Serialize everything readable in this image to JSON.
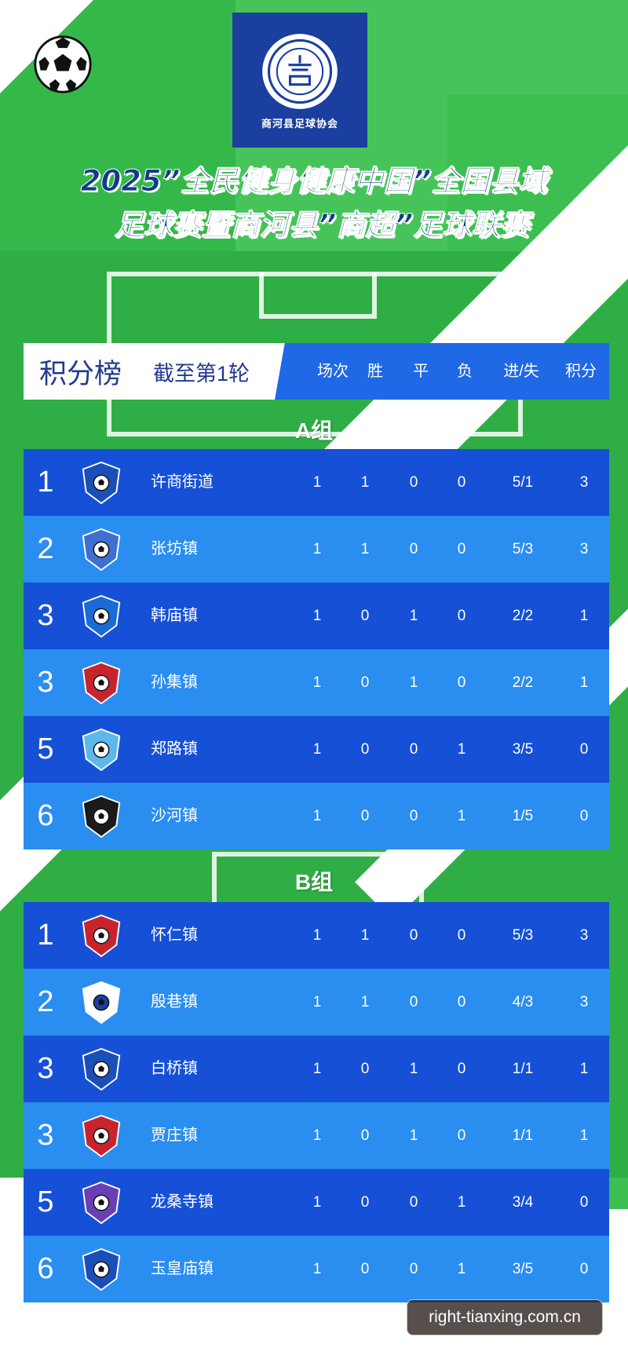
{
  "header": {
    "logo_caption": "商河县足球协会",
    "title_line1": "2025”全民健身健康中国”全国县域",
    "title_line2": "足球赛暨商河县”商超”足球联赛"
  },
  "table": {
    "title": "积分榜",
    "round": "截至第1轮",
    "columns": [
      "场次",
      "胜",
      "平",
      "负",
      "进/失",
      "积分"
    ]
  },
  "groups": [
    {
      "label": "A组",
      "rows": [
        {
          "rank": "1",
          "team": "许商街道",
          "played": "1",
          "won": "1",
          "drawn": "0",
          "lost": "0",
          "goals": "5/1",
          "points": "3",
          "badge": "football-club-shield-icon"
        },
        {
          "rank": "2",
          "team": "张坊镇",
          "played": "1",
          "won": "1",
          "drawn": "0",
          "lost": "0",
          "goals": "5/3",
          "points": "3",
          "badge": "blue-crest-icon"
        },
        {
          "rank": "3",
          "team": "韩庙镇",
          "played": "1",
          "won": "0",
          "drawn": "1",
          "lost": "0",
          "goals": "2/2",
          "points": "1",
          "badge": "football-shield-icon"
        },
        {
          "rank": "3",
          "team": "孙集镇",
          "played": "1",
          "won": "0",
          "drawn": "1",
          "lost": "0",
          "goals": "2/2",
          "points": "1",
          "badge": "red-football-club-icon"
        },
        {
          "rank": "5",
          "team": "郑路镇",
          "played": "1",
          "won": "0",
          "drawn": "0",
          "lost": "1",
          "goals": "3/5",
          "points": "0",
          "badge": "winged-club-icon"
        },
        {
          "rank": "6",
          "team": "沙河镇",
          "played": "1",
          "won": "0",
          "drawn": "0",
          "lost": "1",
          "goals": "1/5",
          "points": "0",
          "badge": "green-shield-icon"
        }
      ]
    },
    {
      "label": "B组",
      "rows": [
        {
          "rank": "1",
          "team": "怀仁镇",
          "played": "1",
          "won": "1",
          "drawn": "0",
          "lost": "0",
          "goals": "5/3",
          "points": "3",
          "badge": "red-football-shield-icon"
        },
        {
          "rank": "2",
          "team": "殷巷镇",
          "played": "1",
          "won": "1",
          "drawn": "0",
          "lost": "0",
          "goals": "4/3",
          "points": "3",
          "badge": "lions-shield-icon"
        },
        {
          "rank": "3",
          "team": "白桥镇",
          "played": "1",
          "won": "0",
          "drawn": "1",
          "lost": "0",
          "goals": "1/1",
          "points": "1",
          "badge": "blue-crown-shield-icon"
        },
        {
          "rank": "3",
          "team": "贾庄镇",
          "played": "1",
          "won": "0",
          "drawn": "1",
          "lost": "0",
          "goals": "1/1",
          "points": "1",
          "badge": "black-red-club-icon"
        },
        {
          "rank": "5",
          "team": "龙桑寺镇",
          "played": "1",
          "won": "0",
          "drawn": "0",
          "lost": "1",
          "goals": "3/4",
          "points": "0",
          "badge": "victory-shield-icon"
        },
        {
          "rank": "6",
          "team": "玉皇庙镇",
          "played": "1",
          "won": "0",
          "drawn": "0",
          "lost": "1",
          "goals": "3/5",
          "points": "0",
          "badge": "football-club-crest-icon"
        }
      ]
    }
  ],
  "watermark": "right-tianxing.com.cn",
  "colors": {
    "row_dark": "#1550d6",
    "row_light": "#2a8df0",
    "header_blue": "#1f68e6",
    "title_navy": "#123a8a",
    "green": "#35b84a"
  }
}
